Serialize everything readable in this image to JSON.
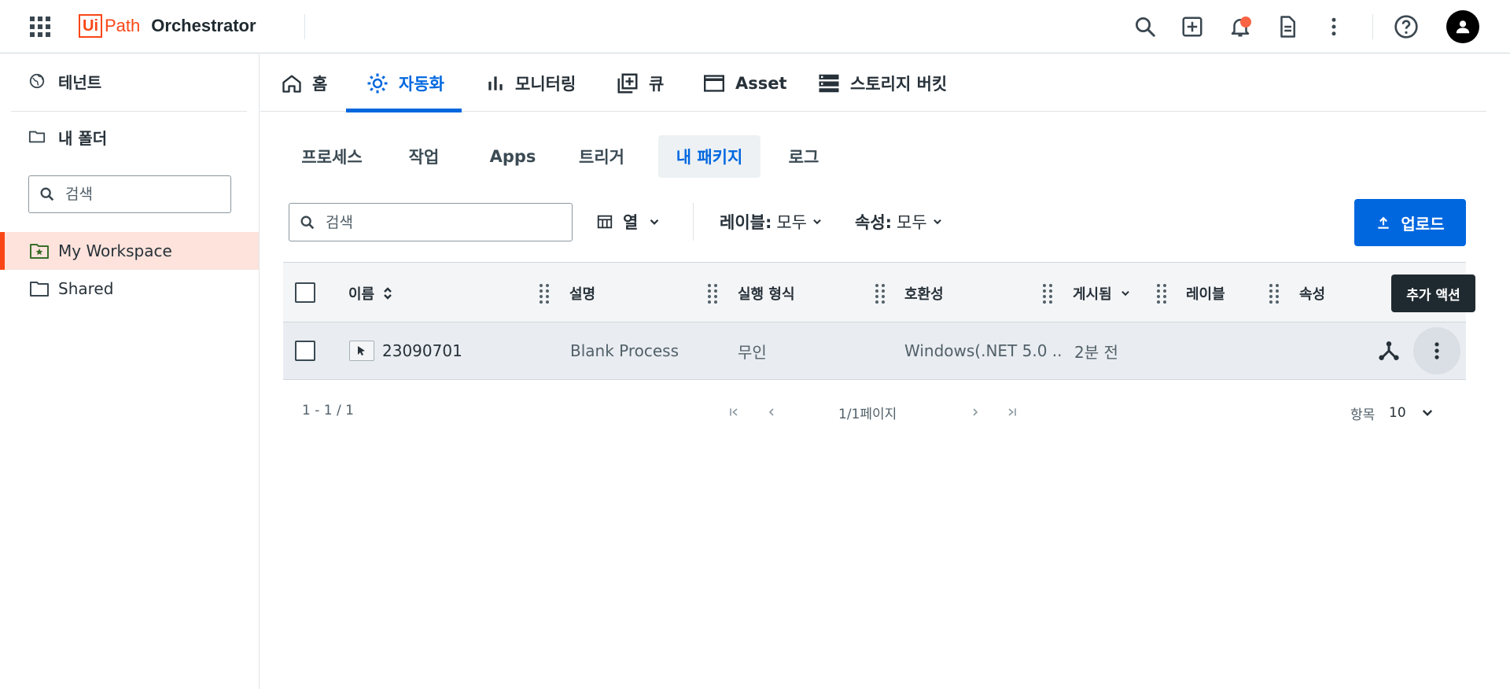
{
  "header": {
    "logo_ui": "Ui",
    "logo_path": "Path",
    "product": "Orchestrator",
    "icons": [
      "apps-grid-icon",
      "search-icon",
      "add-icon",
      "bell-icon",
      "document-icon",
      "more-vert-icon",
      "help-icon",
      "account-icon"
    ],
    "brand_color": "#fa4616",
    "notification_dot_color": "#fa6444"
  },
  "sidebar": {
    "tenant": "테넌트",
    "my_folder": "내 폴더",
    "search_placeholder": "검색",
    "items": [
      {
        "label": "My Workspace",
        "active": true
      },
      {
        "label": "Shared",
        "active": false
      }
    ]
  },
  "main_tabs": [
    {
      "label": "홈",
      "icon": "home-icon",
      "active": false
    },
    {
      "label": "자동화",
      "icon": "automation-gear-icon",
      "active": true
    },
    {
      "label": "모니터링",
      "icon": "bar-chart-icon",
      "active": false
    },
    {
      "label": "큐",
      "icon": "queue-icon",
      "active": false
    },
    {
      "label": "Asset",
      "icon": "asset-icon",
      "active": false
    },
    {
      "label": "스토리지 버킷",
      "icon": "storage-icon",
      "active": false
    }
  ],
  "sub_tabs": [
    {
      "label": "프로세스",
      "active": false
    },
    {
      "label": "작업",
      "active": false
    },
    {
      "label": "Apps",
      "active": false
    },
    {
      "label": "트리거",
      "active": false
    },
    {
      "label": "내 패키지",
      "active": true
    },
    {
      "label": "로그",
      "active": false
    }
  ],
  "toolbar": {
    "search_placeholder": "검색",
    "columns_label": "열",
    "label_filter_key": "레이블:",
    "label_filter_value": "모두",
    "property_filter_key": "속성:",
    "property_filter_value": "모두",
    "upload_label": "업로드",
    "accent_color": "#0067df"
  },
  "table": {
    "columns": [
      "이름",
      "설명",
      "실행 형식",
      "호환성",
      "게시됨",
      "레이블",
      "속성"
    ],
    "rows": [
      {
        "name": "23090701",
        "description": "Blank Process",
        "execution_type": "무인",
        "compatibility": "Windows(.NET 5.0 ...",
        "published": "2분 전",
        "labels": "",
        "properties": ""
      }
    ],
    "tooltip": "추가 액션"
  },
  "pager": {
    "range": "1 - 1 / 1",
    "page_info": "1/1페이지",
    "per_page_label": "항목",
    "per_page_value": "10"
  }
}
